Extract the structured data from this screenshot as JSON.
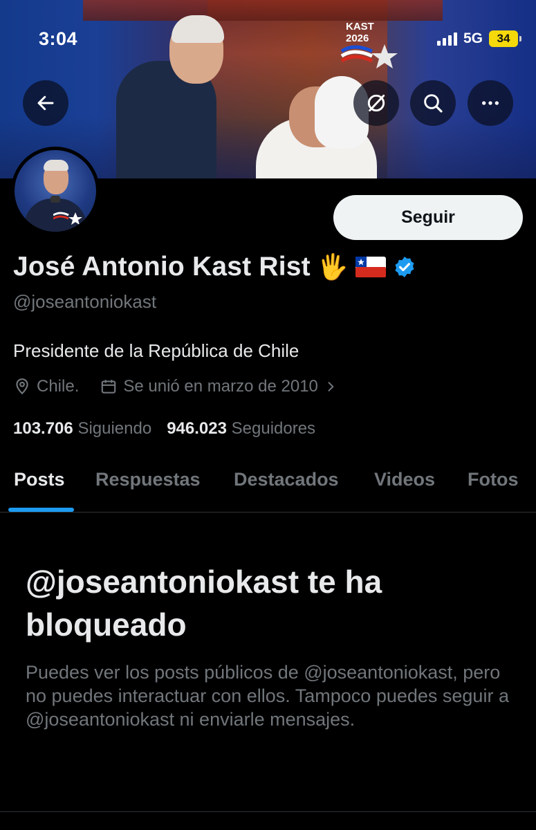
{
  "status_bar": {
    "time": "3:04",
    "network": "5G",
    "battery": "34"
  },
  "banner": {
    "logo_line1": "KAST",
    "logo_line2": "2026"
  },
  "header_buttons": {
    "back": "back-arrow-icon",
    "grok": "grok-icon",
    "search": "search-icon",
    "more": "more-icon"
  },
  "profile": {
    "name": "José Antonio Kast Rist",
    "hand_emoji": "🖐",
    "handle": "@joseantoniokast",
    "bio": "Presidente de la República de Chile",
    "location": "Chile.",
    "joined": "Se unió en marzo de 2010",
    "following_count": "103.706",
    "following_label": "Siguiendo",
    "followers_count": "946.023",
    "followers_label": "Seguidores",
    "verified_color": "#1d9bf0"
  },
  "actions": {
    "follow_label": "Seguir"
  },
  "tabs": [
    {
      "label": "Posts",
      "active": true
    },
    {
      "label": "Respuestas",
      "active": false
    },
    {
      "label": "Destacados",
      "active": false
    },
    {
      "label": "Videos",
      "active": false
    },
    {
      "label": "Fotos",
      "active": false
    }
  ],
  "blocked": {
    "title": "@joseantoniokast te ha bloqueado",
    "body": "Puedes ver los posts públicos de @joseantoniokast, pero no puedes interactuar con ellos. Tampoco puedes seguir a @joseantoniokast ni enviarle mensajes."
  },
  "colors": {
    "accent": "#1d9bf0",
    "background": "#000000",
    "primary_text": "#e7e9ea",
    "secondary_text": "#71767b",
    "battery": "#f5d90a"
  }
}
